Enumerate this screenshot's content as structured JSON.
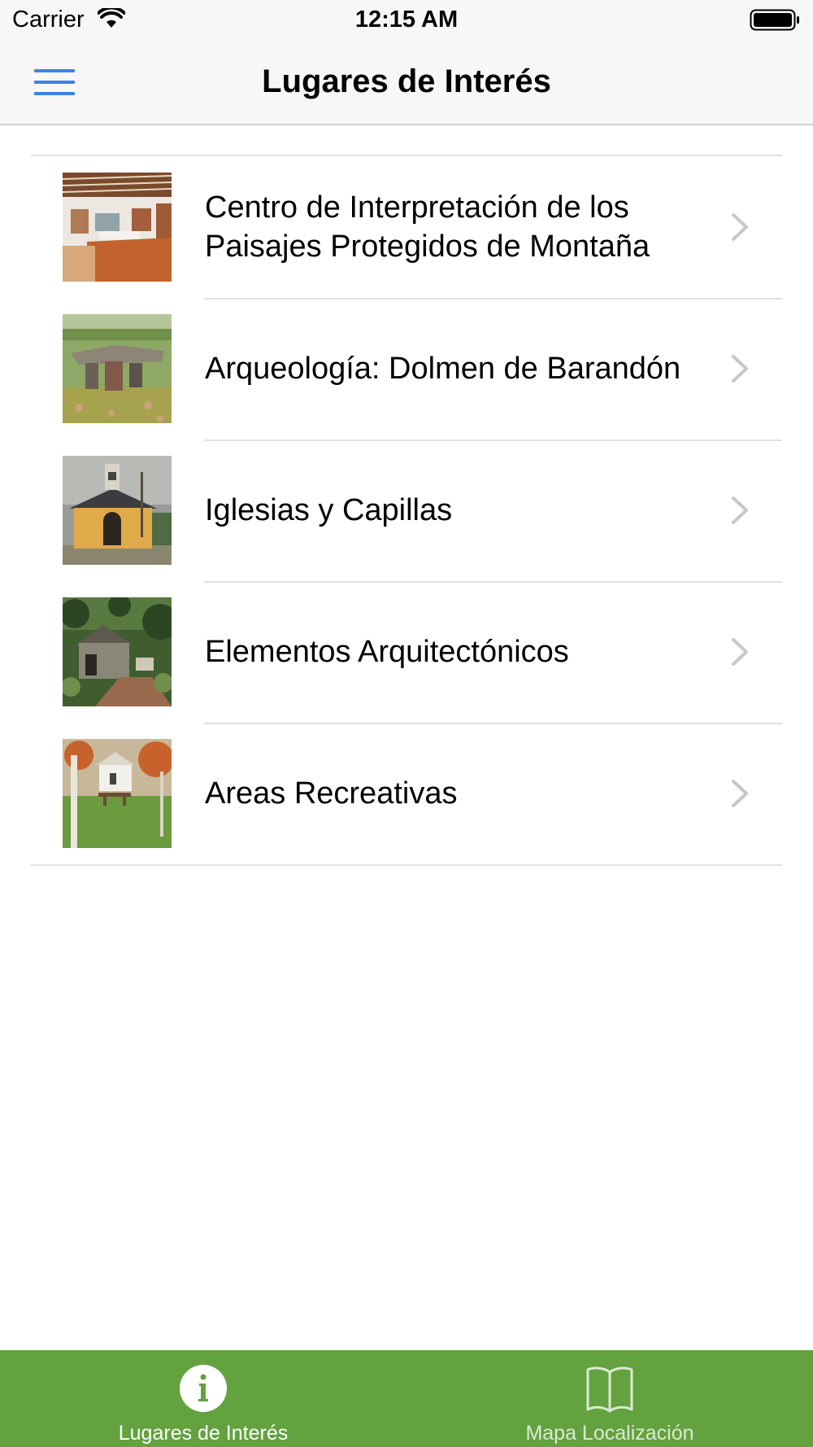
{
  "status_bar": {
    "carrier": "Carrier",
    "time": "12:15 AM",
    "wifi_icon": "wifi-icon",
    "battery_icon": "battery-full-icon"
  },
  "nav_bar": {
    "title": "Lugares de Interés",
    "menu_icon": "hamburger-menu-icon",
    "accent_color": "#3d82e8"
  },
  "list": {
    "items": [
      {
        "label": "Centro de Interpretación de los Paisajes Protegidos de Montaña",
        "thumbnail": "museum-interior-photo"
      },
      {
        "label": "Arqueología: Dolmen de Barandón",
        "thumbnail": "dolmen-stone-photo"
      },
      {
        "label": "Iglesias y Capillas",
        "thumbnail": "chapel-photo"
      },
      {
        "label": "Elementos Arquitectónicos",
        "thumbnail": "stone-hut-forest-photo"
      },
      {
        "label": "Areas Recreativas",
        "thumbnail": "picnic-area-photo"
      }
    ],
    "chevron_icon": "chevron-right-icon"
  },
  "tab_bar": {
    "background_color": "#63a23f",
    "tabs": [
      {
        "label": "Lugares de Interés",
        "icon": "info-circle-icon",
        "selected": true
      },
      {
        "label": "Mapa Localización",
        "icon": "book-map-icon",
        "selected": false
      }
    ]
  }
}
